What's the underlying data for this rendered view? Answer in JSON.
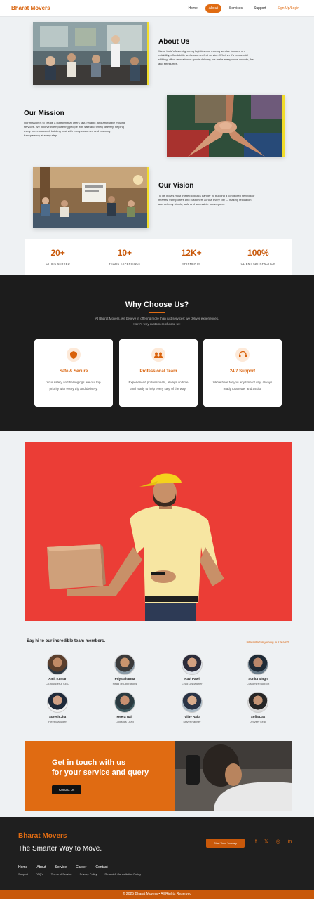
{
  "nav": {
    "brand": "Bharat Movers",
    "links": [
      "Home",
      "About",
      "Services",
      "Support"
    ],
    "active": "About",
    "signup": "Sign Up/Login"
  },
  "about": {
    "title": "About Us",
    "text": "We're India's fastest-growing logistics and moving service focused on reliability, affordability and customer-first service. Whether it's household shifting, office relocation or goods delivery, we make every move smooth, fast and stress-free."
  },
  "mission": {
    "title": "Our Mission",
    "text": "Our mission is to create a platform that offers fast, reliable, and affordable moving services. We believe in empowering people with safe and timely delivery, helping every move succeed, building trust with every customer, and ensuring transparency at every step."
  },
  "vision": {
    "title": "Our Vision",
    "text": "To be India's most trusted logistics partner by building a connected network of movers, transporters and customers across every city — making relocation and delivery simple, safe and accessible to everyone."
  },
  "stats": [
    {
      "value": "20+",
      "label": "CITIES SERVED"
    },
    {
      "value": "10+",
      "label": "YEARS EXPERIENCE"
    },
    {
      "value": "12K+",
      "label": "SHIPMENTS"
    },
    {
      "value": "100%",
      "label": "CLIENT SATISFACTION"
    }
  ],
  "why": {
    "title": "Why Choose Us?",
    "subtitle": "At Bharat Movers, we believe in offering more than just services: we deliver experiences. Here's why customers choose us:",
    "cards": [
      {
        "icon": "shield-icon",
        "title": "Safe & Secure",
        "text": "Your safety and belongings are our top priority with every trip and delivery."
      },
      {
        "icon": "users-icon",
        "title": "Professional Team",
        "text": "Experienced professionals, always on time and ready to help every step of the way."
      },
      {
        "icon": "headset-icon",
        "title": "24/7 Support",
        "text": "We're here for you any time of day, always ready to answer and assist."
      }
    ]
  },
  "team": {
    "heading": "Say hi to our incredible team members.",
    "link": "Interested in joining our team?",
    "members": [
      {
        "name": "Amit Kumar",
        "role": "Co-founder & CEO"
      },
      {
        "name": "Priya Sharma",
        "role": "Head of Operations"
      },
      {
        "name": "Ravi Patel",
        "role": "Lead Dispatcher"
      },
      {
        "name": "Sunita Singh",
        "role": "Customer Support"
      },
      {
        "name": "Suresh Jha",
        "role": "Fleet Manager"
      },
      {
        "name": "Meera Nair",
        "role": "Logistics Lead"
      },
      {
        "name": "Vijay Raju",
        "role": "Driver Partner"
      },
      {
        "name": "Sofia Das",
        "role": "Delivery Lead"
      }
    ]
  },
  "contact": {
    "title_line1": "Get in touch with us",
    "title_line2": "for your service and query",
    "button": "Contact Us"
  },
  "footer": {
    "brand": "Bharat Movers",
    "tagline": "The Smarter Way to Move.",
    "button": "Start Your Journey",
    "social": [
      "facebook-icon",
      "x-icon",
      "instagram-icon",
      "linkedin-icon"
    ],
    "links1": [
      "Home",
      "About",
      "Service",
      "Career",
      "Contact"
    ],
    "links2": [
      "Support",
      "FAQ's",
      "Terms of Service",
      "Privacy Policy",
      "Refund & Cancellation Policy"
    ],
    "copyright": "© 2025 Bharat Movers • All Rights Reserved"
  },
  "colors": {
    "accent": "#e06b12",
    "hero": "#eb3d36",
    "dark": "#1c1c1c"
  }
}
